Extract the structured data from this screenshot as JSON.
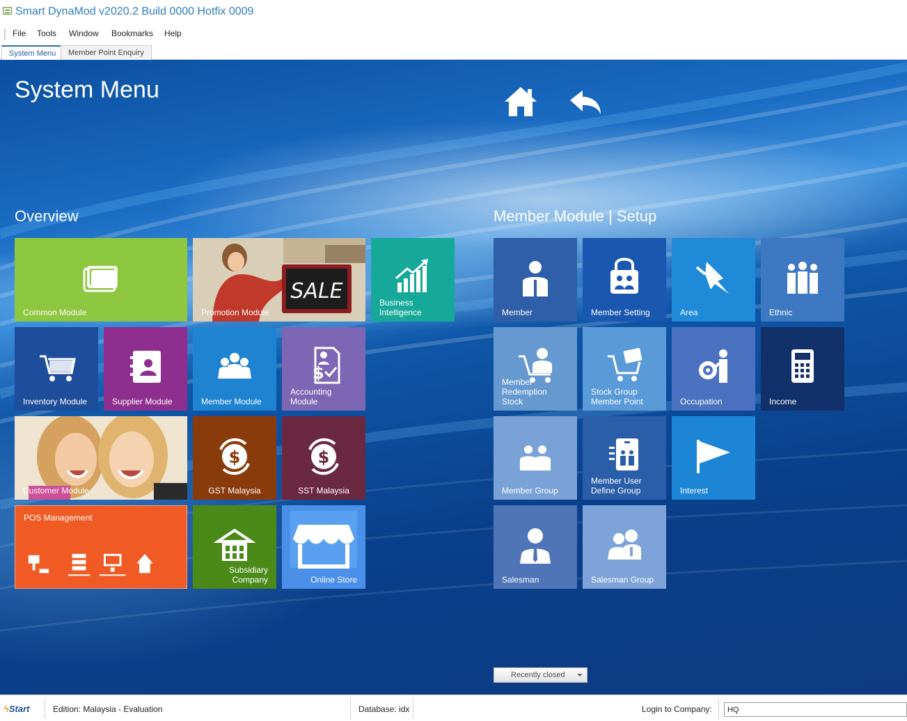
{
  "window": {
    "title": "Smart DynaMod v2020.2 Build 0000 Hotfix 0009"
  },
  "menubar": {
    "items": [
      "File",
      "Tools",
      "Window",
      "Bookmarks",
      "Help"
    ]
  },
  "tabs": [
    {
      "label": "System Menu",
      "active": true
    },
    {
      "label": "Member Point Enquiry",
      "active": false
    }
  ],
  "page": {
    "title": "System Menu"
  },
  "nav": {
    "home_icon": "home-icon",
    "back_icon": "back-arrow-icon"
  },
  "overview": {
    "heading": "Overview",
    "tiles": [
      {
        "id": "common-module",
        "label": "Common Module",
        "color": "#8dc63f",
        "icon": "folder-stack-icon"
      },
      {
        "id": "promotion-module",
        "label": "Promotion Module",
        "color": "#c0392b",
        "icon": "sale-photo",
        "image_text": "SALE"
      },
      {
        "id": "business-intelligence",
        "label_lines": [
          "Business",
          "Intelligence"
        ],
        "color": "#16a999",
        "icon": "growth-chart-icon"
      },
      {
        "id": "inventory-module",
        "label": "Inventory Module",
        "color": "#1e4d9b",
        "icon": "shopping-cart-icon"
      },
      {
        "id": "supplier-module",
        "label": "Supplier Module",
        "color": "#8e2f8f",
        "icon": "contact-book-icon"
      },
      {
        "id": "member-module",
        "label": "Member Module",
        "color": "#1e83d0",
        "icon": "people-group-icon"
      },
      {
        "id": "accounting-module",
        "label_lines": [
          "Accounting",
          "Module"
        ],
        "color": "#7d66b3",
        "icon": "accounting-document-icon"
      },
      {
        "id": "customer-module",
        "label": "Customer Module",
        "color": "#e7b98c",
        "icon": "customer-photo"
      },
      {
        "id": "gst-malaysia",
        "label": "GST Malaysia",
        "color": "#8a3b0b",
        "icon": "dollar-cycle-icon"
      },
      {
        "id": "sst-malaysia",
        "label": "SST Malaysia",
        "color": "#6b2941",
        "icon": "dollar-cycle-icon"
      },
      {
        "id": "pos-management",
        "label": "POS Management",
        "color": "#f05a24",
        "icon": "network-devices-icon"
      },
      {
        "id": "subsidiary-company",
        "label_lines": [
          "Subsidiary",
          "Company"
        ],
        "color": "#4b8a18",
        "icon": "store-basket-icon"
      },
      {
        "id": "online-store",
        "label": "Online Store",
        "color": "#4a90e8",
        "icon": "storefront-awning-icon"
      }
    ]
  },
  "member_setup": {
    "heading": "Member Module | Setup",
    "tiles": [
      {
        "id": "member",
        "label": "Member",
        "color": "#2e5fa8",
        "icon": "person-icon"
      },
      {
        "id": "member-setting",
        "label": "Member Setting",
        "color": "#1a57b0",
        "icon": "lock-people-icon"
      },
      {
        "id": "area",
        "label": "Area",
        "color": "#1f8ad8",
        "icon": "pushpin-icon"
      },
      {
        "id": "ethnic",
        "label": "Ethnic",
        "color": "#3f78c2",
        "icon": "group-of-three-icon"
      },
      {
        "id": "member-redemption-stock",
        "label_lines": [
          "Member",
          "Redemption",
          "Stock"
        ],
        "color": "#6699d0",
        "icon": "person-cart-icon"
      },
      {
        "id": "stock-group-member-point",
        "label_lines": [
          "Stock Group",
          "Member Point"
        ],
        "color": "#5a9ad8",
        "icon": "cart-card-icon"
      },
      {
        "id": "occupation",
        "label": "Occupation",
        "color": "#4b72c0",
        "icon": "gear-person-icon"
      },
      {
        "id": "income",
        "label": "Income",
        "color": "#12316a",
        "icon": "calculator-icon"
      },
      {
        "id": "member-group",
        "label": "Member Group",
        "color": "#7aa2d6",
        "icon": "two-people-icon"
      },
      {
        "id": "member-user-define-group",
        "label_lines": [
          "Member User",
          "Define Group"
        ],
        "color": "#2b5ea9",
        "icon": "id-badge-group-icon"
      },
      {
        "id": "interest",
        "label": "Interest",
        "color": "#1c85d6",
        "icon": "flag-icon"
      },
      {
        "id": "salesman",
        "label": "Salesman",
        "color": "#4f74b7",
        "icon": "salesman-icon"
      },
      {
        "id": "salesman-group",
        "label": "Salesman Group",
        "color": "#7ea3d8",
        "icon": "salesman-group-icon"
      }
    ]
  },
  "recently_closed": {
    "label": "Recently closed"
  },
  "statusbar": {
    "start_label": "Start",
    "edition": "Edition: Malaysia - Evaluation",
    "database": "Database: idx",
    "login_label": "Login to Company:",
    "login_value": "HQ"
  }
}
